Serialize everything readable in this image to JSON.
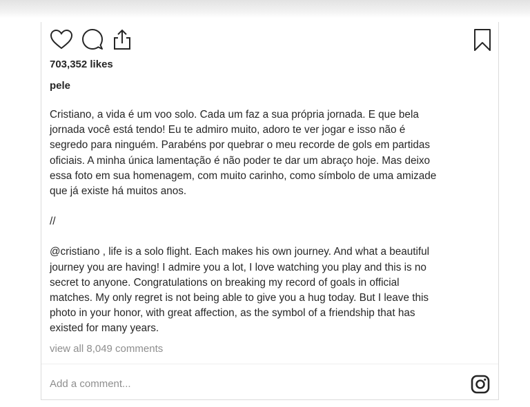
{
  "post": {
    "likes": "703,352 likes",
    "username": "pele",
    "caption_pt": "Cristiano, a vida é um voo solo. Cada um faz a sua própria jornada. E que bela\njornada você está tendo! Eu te admiro muito, adoro te ver jogar e isso não é\nsegredo para ninguém. Parabéns por quebrar o meu recorde de gols em partidas\noficiais. A minha única lamentação é não poder te dar um abraço hoje. Mas deixo\nessa foto em sua homenagem, com muito carinho, como símbolo de uma amizade\nque já existe há muitos anos.",
    "separator": "//",
    "caption_en": "@cristiano , life is a solo flight. Each makes his own journey. And what a beautiful\njourney you are having! I admire you a lot, I love watching you play and this is no\nsecret to anyone. Congratulations on breaking my record of goals in official\nmatches. My only regret is not being able to give you a hug today. But I leave this\nphoto in your honor, with great affection, as the symbol of a friendship that has\nexisted for many years.",
    "view_all_comments": "view all 8,049 comments"
  },
  "comment_box": {
    "placeholder": "Add a comment..."
  },
  "icons": {
    "like": "heart-icon",
    "comment": "comment-bubble-icon",
    "share": "share-icon",
    "save": "bookmark-icon",
    "instagram": "instagram-logo-icon"
  }
}
